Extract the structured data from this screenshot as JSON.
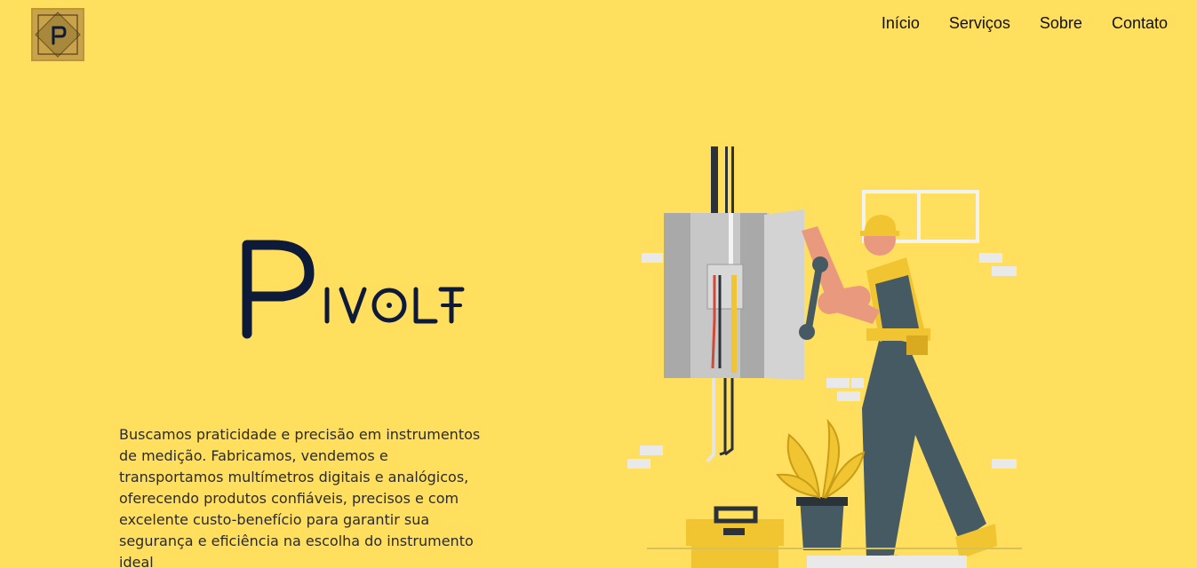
{
  "header": {
    "logo_icon": "pivolt-badge-logo",
    "nav": [
      {
        "label": "Início"
      },
      {
        "label": "Serviços"
      },
      {
        "label": "Sobre"
      },
      {
        "label": "Contato"
      }
    ]
  },
  "hero": {
    "brand_name": "PIVOLT",
    "description": "Buscamos praticidade e precisão em instrumentos de medição. Fabricamos, vendemos e transportamos multímetros digitais e analógicos, oferecendo produtos confiáveis, precisos e com excelente custo-benefício para garantir sua segurança e eficiência na escolha do instrumento ideal",
    "illustration_icon": "electrician-illustration"
  },
  "colors": {
    "background": "#ffdf5d",
    "brand_navy": "#0d1a3a",
    "text": "#2b2b2b"
  }
}
